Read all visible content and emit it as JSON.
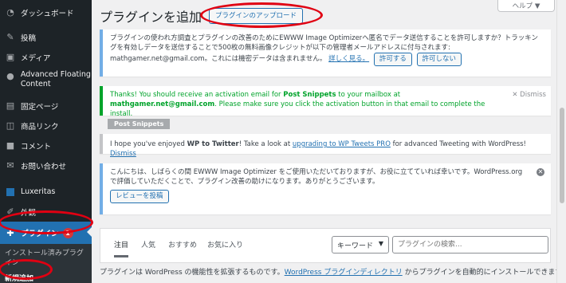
{
  "sidebar": {
    "items": [
      {
        "label": "ダッシュボード",
        "icon": "dashboard-icon"
      },
      {
        "label": "投稿",
        "icon": "pin-icon"
      },
      {
        "label": "メディア",
        "icon": "media-icon"
      },
      {
        "label": "Advanced Floating Content",
        "icon": "floating-content-icon"
      },
      {
        "label": "固定ページ",
        "icon": "pages-icon"
      },
      {
        "label": "商品リンク",
        "icon": "product-link-icon"
      },
      {
        "label": "コメント",
        "icon": "comment-icon"
      },
      {
        "label": "お問い合わせ",
        "icon": "mail-icon"
      },
      {
        "label": "Luxeritas",
        "icon": "luxeritas-icon"
      },
      {
        "label": "外観",
        "icon": "appearance-icon"
      },
      {
        "label": "プラグイン",
        "icon": "plugin-icon",
        "badge": "1"
      }
    ],
    "submenu": [
      "インストール済みプラグイン",
      "新規追加"
    ]
  },
  "header": {
    "title": "プラグインを追加",
    "upload_button": "プラグインのアップロード",
    "help": "ヘルプ ▼"
  },
  "notices": {
    "ewww_tracking": {
      "text": "プラグインの使われ方調査とプラグインの改善のためにEWWW Image Optimizerへ匿名でデータ送信することを許可しますか？トラッキングを有効しデータを送信することで500枚の無料画像クレジットが以下の管理者メールアドレスに付与されます: mathgamer.net@gmail.com。これには機密データは含まれません。",
      "link": "詳しく見る。",
      "allow": "許可する",
      "deny": "許可しない"
    },
    "post_snippets": {
      "text_pre": "Thanks! You should receive an activation email for ",
      "bold1": "Post Snippets",
      "text_mid": " to your mailbox at ",
      "bold2": "mathgamer.net@gmail.com",
      "text_post": ". Please make sure you click the activation button in that email to complete the install.",
      "dismiss": "Dismiss",
      "tag": "Post Snippets"
    },
    "wp_to_twitter": {
      "text_pre": "I hope you've enjoyed ",
      "bold": "WP to Twitter",
      "text_mid": "! Take a look at ",
      "link": "upgrading to WP Tweets PRO",
      "text_post": " for advanced Tweeting with WordPress! ",
      "dismiss": "Dismiss"
    },
    "ewww_review": {
      "text": "こんにちは、しばらくの間 EWWW Image Optimizer をご使用いただいておりますが、お役に立てていれば幸いです。WordPress.org で評価していただくことで、プラグイン改善の助けになります。ありがとうございます。",
      "button": "レビューを投稿"
    }
  },
  "filter": {
    "tabs": [
      "注目",
      "人気",
      "おすすめ",
      "お気に入り"
    ],
    "select_value": "キーワード",
    "search_placeholder": "プラグインの検索..."
  },
  "description": {
    "pre": "プラグインは WordPress の機能性を拡張するものです。",
    "link": "WordPress プラグインディレクトリ",
    "post": " からプラグインを自動的にインストールできます。またはこのページの最上部にあるボタンをクリックして .zip 形式でプラグインをアップロードしてください。"
  },
  "colors": {
    "sidebar_bg": "#1d2327",
    "active_bg": "#2271b1",
    "highlight_red": "#e00012",
    "notice_info": "#72aee6",
    "notice_success": "#00a32a"
  }
}
